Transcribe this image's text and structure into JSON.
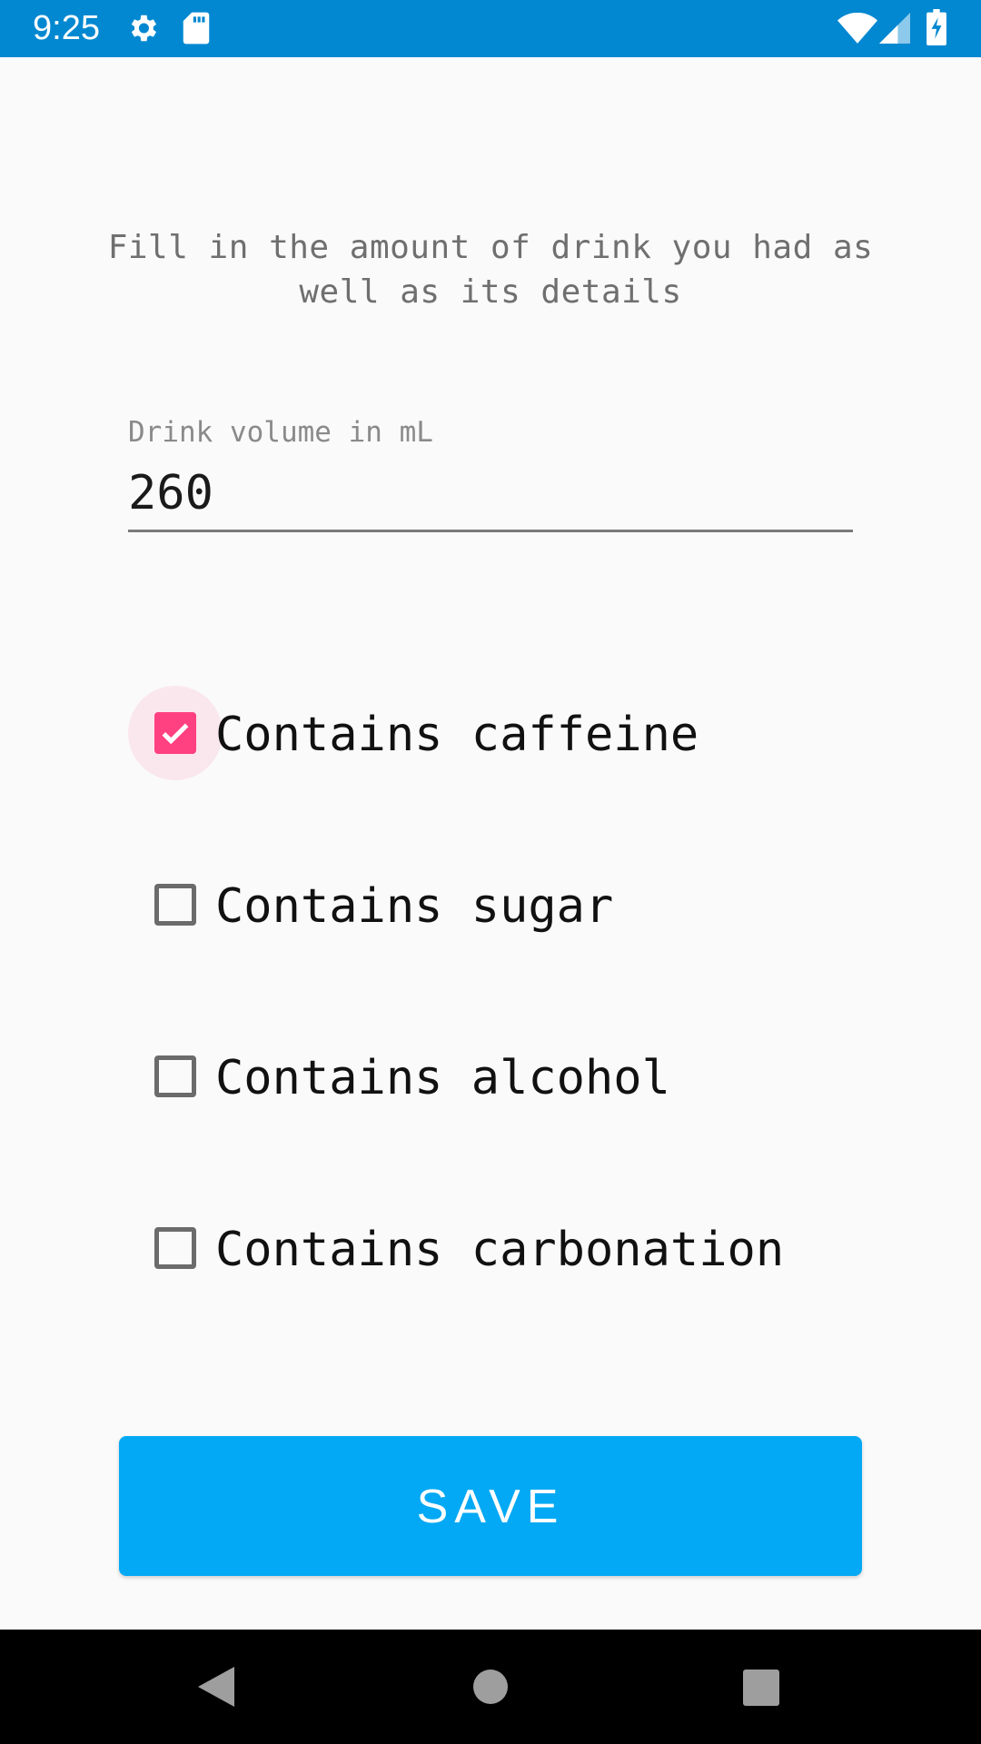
{
  "status_bar": {
    "time": "9:25",
    "background": "#0288d1",
    "icons_left": [
      "gear-icon",
      "sd-card-icon"
    ],
    "icons_right": [
      "wifi-icon",
      "cell-signal-icon",
      "battery-charging-icon"
    ]
  },
  "form": {
    "instruction": "Fill in the amount of drink you had as well as its details",
    "volume": {
      "label": "Drink volume in mL",
      "value": "260"
    },
    "checkboxes": [
      {
        "label": "Contains caffeine",
        "checked": true
      },
      {
        "label": "Contains sugar",
        "checked": false
      },
      {
        "label": "Contains alcohol",
        "checked": false
      },
      {
        "label": "Contains carbonation",
        "checked": false
      }
    ],
    "save_label": "SAVE"
  },
  "colors": {
    "accent": "#ff4081",
    "button": "#03a9f4",
    "background": "#fafafa"
  },
  "nav_bar": {
    "icons": [
      "back-icon",
      "home-icon",
      "recents-icon"
    ]
  }
}
